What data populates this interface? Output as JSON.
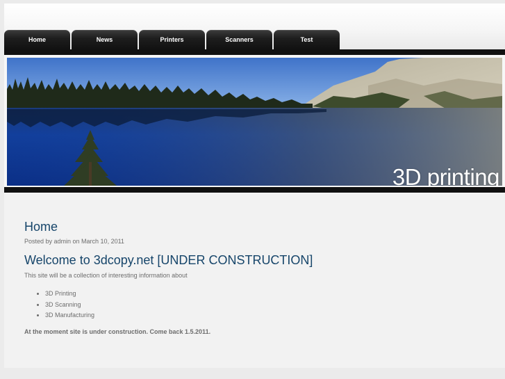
{
  "nav": {
    "tabs": [
      {
        "label": "Home"
      },
      {
        "label": "News"
      },
      {
        "label": "Printers"
      },
      {
        "label": "Scanners"
      },
      {
        "label": "Test"
      }
    ]
  },
  "banner": {
    "title": "3D printing"
  },
  "content": {
    "page_title": "Home",
    "post_meta": "Posted by admin on March 10, 2011",
    "post_heading": "Welcome to 3dcopy.net [UNDER CONSTRUCTION]",
    "intro": "This site will be a collection of interesting information about",
    "topics": [
      "3D Printing",
      "3D Scanning",
      "3D Manufacturing"
    ],
    "notice": "At the moment site is under construction. Come back 1.5.2011."
  },
  "colors": {
    "heading": "#16456a",
    "nav_tab": "#1e1e1e",
    "body_text": "#6c6c6c"
  }
}
